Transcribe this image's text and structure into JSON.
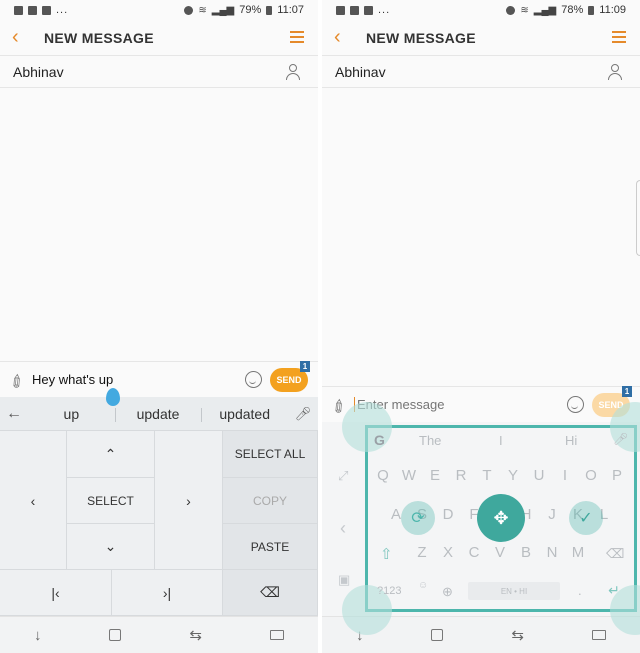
{
  "left": {
    "status": {
      "battery": "79%",
      "time": "11:07"
    },
    "header": {
      "title": "NEW MESSAGE"
    },
    "recipient": "Abhinav",
    "compose_text": "Hey what's up",
    "send_label": "SEND",
    "send_badge": "1",
    "suggestions": [
      "up",
      "update",
      "updated"
    ],
    "edit": {
      "select": "SELECT",
      "select_all": "SELECT ALL",
      "copy": "COPY",
      "paste": "PASTE"
    }
  },
  "right": {
    "status": {
      "battery": "78%",
      "time": "11:09"
    },
    "header": {
      "title": "NEW MESSAGE"
    },
    "recipient": "Abhinav",
    "compose_placeholder": "Enter message",
    "send_label": "SEND",
    "send_badge": "1",
    "suggestions": [
      "The",
      "I",
      "Hi"
    ],
    "keys_row1": [
      "Q",
      "W",
      "E",
      "R",
      "T",
      "Y",
      "U",
      "I",
      "O",
      "P"
    ],
    "keys_row2": [
      "A",
      "S",
      "D",
      "F",
      "G",
      "H",
      "J",
      "K",
      "L"
    ],
    "keys_row3": [
      "Z",
      "X",
      "C",
      "V",
      "B",
      "N",
      "M"
    ],
    "symbols_key": "?123",
    "space_label": "EN • HI",
    "period": "."
  },
  "colors": {
    "accent": "#e58a2b",
    "send": "#f3a11f",
    "badge": "#2f6ea5",
    "teal": "#4db6ac",
    "selection_drop": "#43a9e0"
  }
}
